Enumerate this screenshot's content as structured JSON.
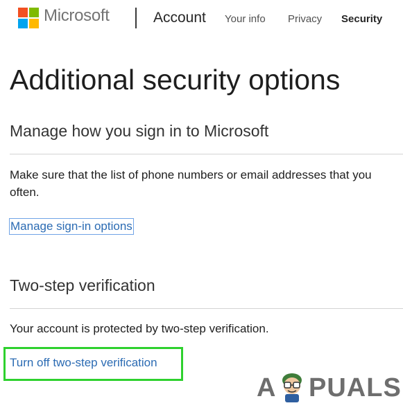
{
  "header": {
    "brand": "Microsoft",
    "section": "Account",
    "nav": [
      "Your info",
      "Privacy",
      "Security"
    ],
    "active_nav": "Security",
    "logo_colors": [
      "#f25022",
      "#7fba00",
      "#00a4ef",
      "#ffb900"
    ]
  },
  "main": {
    "title": "Additional security options",
    "manage": {
      "heading": "Manage how you sign in to Microsoft",
      "text_line1": "Make sure that the list of phone numbers or email addresses that you",
      "text_line2": "often.",
      "link": "Manage sign-in options"
    },
    "two_step": {
      "heading": "Two-step verification",
      "text": "Your account is protected by two-step verification.",
      "link": "Turn off two-step verification",
      "highlight_color": "#2ed12e"
    }
  },
  "watermark": {
    "letter_a": "A",
    "rest": "PUALS"
  }
}
